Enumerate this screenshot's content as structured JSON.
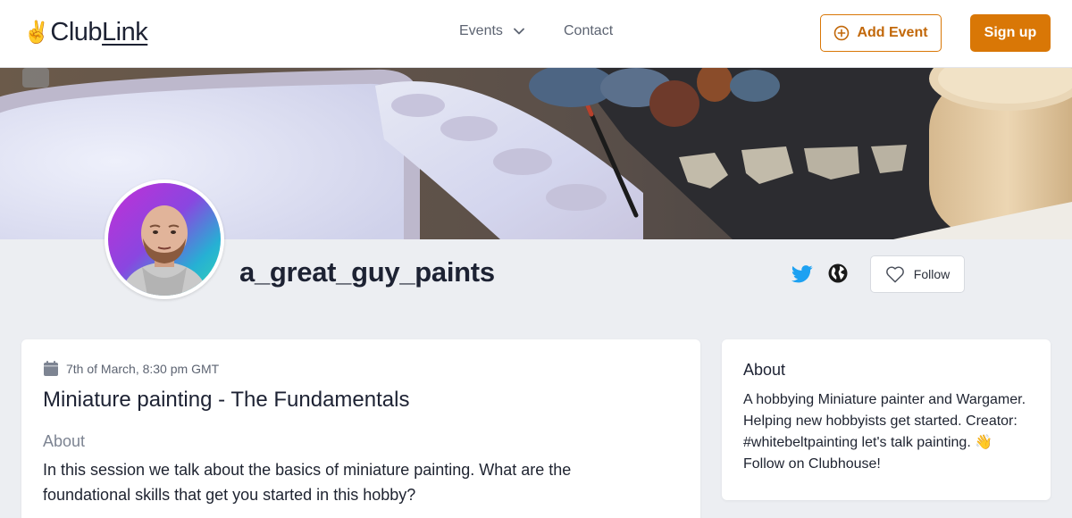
{
  "header": {
    "logo_emoji": "✌️",
    "logo_text_1": "Club",
    "logo_text_2": "Link",
    "nav_events": "Events",
    "nav_contact": "Contact",
    "add_event_label": "Add Event",
    "signup_label": "Sign up"
  },
  "profile": {
    "username": "a_great_guy_paints",
    "follow_label": "Follow"
  },
  "event": {
    "date": "7th of March, 8:30 pm GMT",
    "title": "Miniature painting - The Fundamentals",
    "about_heading": "About",
    "description": "In this session we talk about the basics of miniature painting. What are the foundational skills that get you started in this hobby?"
  },
  "about": {
    "heading": "About",
    "text": "A hobbying Miniature painter and Wargamer. Helping new hobbyists get started. Creator: #whitebeltpainting let's talk painting. 👋 Follow on Clubhouse!"
  },
  "colors": {
    "accent": "#d97706",
    "twitter": "#1da1f2",
    "background": "#eceef2"
  },
  "icons": {
    "add_event": "plus-circle-icon",
    "events_dropdown": "chevron-down-icon",
    "twitter": "twitter-icon",
    "website": "globe-icon",
    "follow": "heart-icon",
    "date": "calendar-icon"
  }
}
